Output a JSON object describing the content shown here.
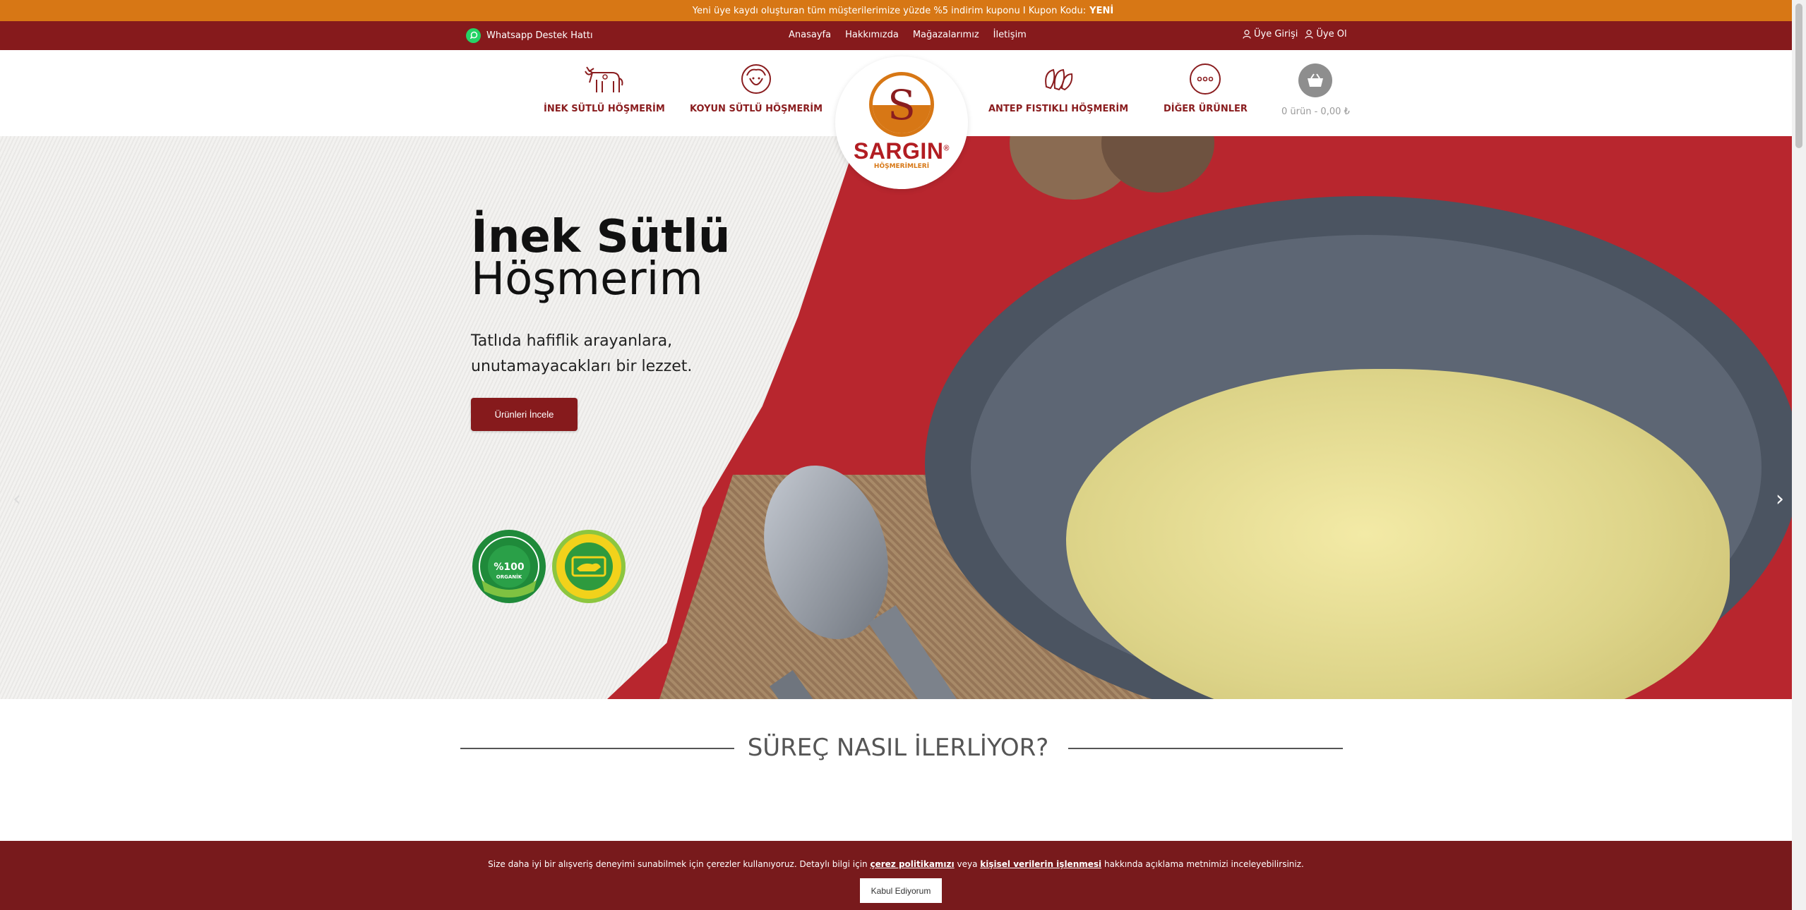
{
  "announcement": {
    "text": "Yeni üye kaydı oluşturan tüm müşterilerimize yüzde %5 indirim kuponu I Kupon Kodu:",
    "code": "YENİ"
  },
  "topbar": {
    "whatsapp_label": "Whatsapp Destek Hattı",
    "links": [
      "Anasayfa",
      "Hakkımızda",
      "Mağazalarımız",
      "İletişim"
    ],
    "login_label": "Üye Girişi",
    "register_label": "Üye Ol"
  },
  "nav": {
    "items": [
      {
        "label": "İNEK SÜTLÜ HÖŞMERİM",
        "icon": "cow-icon"
      },
      {
        "label": "KOYUN SÜTLÜ HÖŞMERİM",
        "icon": "sheep-icon"
      },
      {
        "label": "ANTEP FISTIKLI HÖŞMERİM",
        "icon": "pistachio-icon"
      },
      {
        "label": "DİĞER ÜRÜNLER",
        "icon": "more-icon"
      }
    ],
    "cart_text": "0 ürün - 0,00 ₺"
  },
  "logo": {
    "letter": "S",
    "name": "SARGIN",
    "mark": "®",
    "subtitle": "HÖŞMERİMLERİ"
  },
  "hero": {
    "title_line1": "İnek Sütlü",
    "title_line2": "Höşmerim",
    "subtitle": "Tatlıda hafiflik arayanlara, unutamayacakları bir lezzet.",
    "button_label": "Ürünleri İncele",
    "badges": [
      "DOĞAL PANCAR ŞEKERİ %100 ORGANİK",
      "YERLİ ÜRETİM"
    ]
  },
  "process": {
    "title": "SÜREÇ NASIL İLERLİYOR?"
  },
  "cookie": {
    "text_before": "Size daha iyi bir alışveriş deneyimi sunabilmek için çerezler kullanıyoruz. Detaylı bilgi için",
    "link1": "çerez politikamızı",
    "text_middle": "veya",
    "link2": "kişisel verilerin işlenmesi",
    "text_after": "hakkında açıklama metnimizi inceleyebilirsiniz.",
    "button_label": "Kabul Ediyorum"
  },
  "colors": {
    "announcement": "#d77715",
    "topbar": "#861a1c",
    "brand_red": "#8a1d1f",
    "cookie": "#781a1c"
  }
}
